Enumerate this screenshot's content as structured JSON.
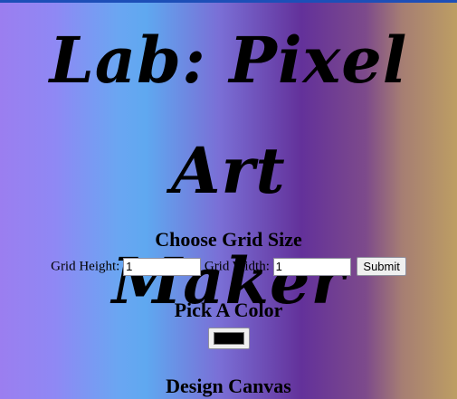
{
  "page": {
    "title_line1": "Lab: Pixel Art",
    "title_line2": "Maker"
  },
  "grid_size": {
    "heading": "Choose Grid Size",
    "height_label": "Grid Height:",
    "height_value": "1",
    "width_label": "Grid Width:",
    "width_value": "1",
    "submit_label": "Submit"
  },
  "color": {
    "heading": "Pick A Color",
    "selected_color": "#000000"
  },
  "canvas": {
    "heading": "Design Canvas"
  },
  "theme": {
    "top_bar_color": "#1d4fb8"
  }
}
